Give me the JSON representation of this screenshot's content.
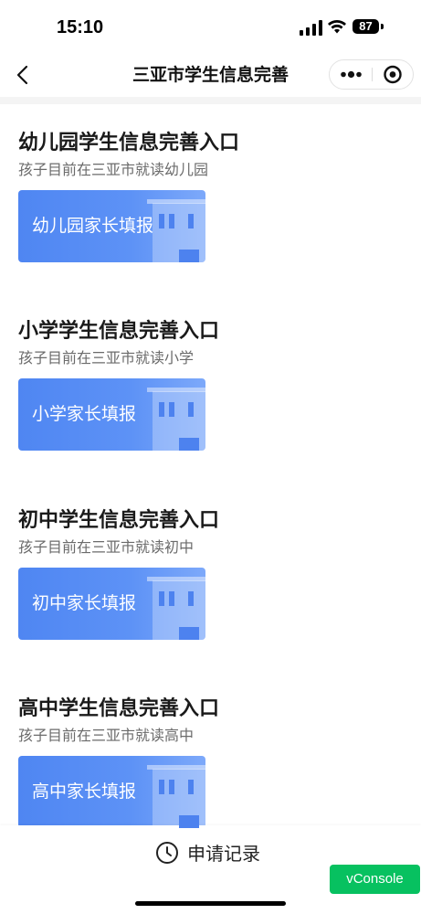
{
  "status_bar": {
    "time": "15:10",
    "battery": "87",
    "icons": [
      "signal-icon",
      "wifi-icon",
      "battery-icon"
    ]
  },
  "nav": {
    "title": "三亚市学生信息完善",
    "back_icon": "back-chevron-icon",
    "more_icon": "more-dots-icon",
    "close_icon": "target-close-icon"
  },
  "sections": [
    {
      "title": "幼儿园学生信息完善入口",
      "subtitle": "孩子目前在三亚市就读幼儿园",
      "button_label": "幼儿园家长填报"
    },
    {
      "title": "小学学生信息完善入口",
      "subtitle": "孩子目前在三亚市就读小学",
      "button_label": "小学家长填报"
    },
    {
      "title": "初中学生信息完善入口",
      "subtitle": "孩子目前在三亚市就读初中",
      "button_label": "初中家长填报"
    },
    {
      "title": "高中学生信息完善入口",
      "subtitle": "孩子目前在三亚市就读高中",
      "button_label": "高中家长填报"
    }
  ],
  "bottom": {
    "record_label": "申请记录",
    "record_icon": "clock-icon"
  },
  "vconsole_label": "vConsole",
  "colors": {
    "card_blue": "#4f86f2",
    "vconsole_green": "#07c160"
  }
}
